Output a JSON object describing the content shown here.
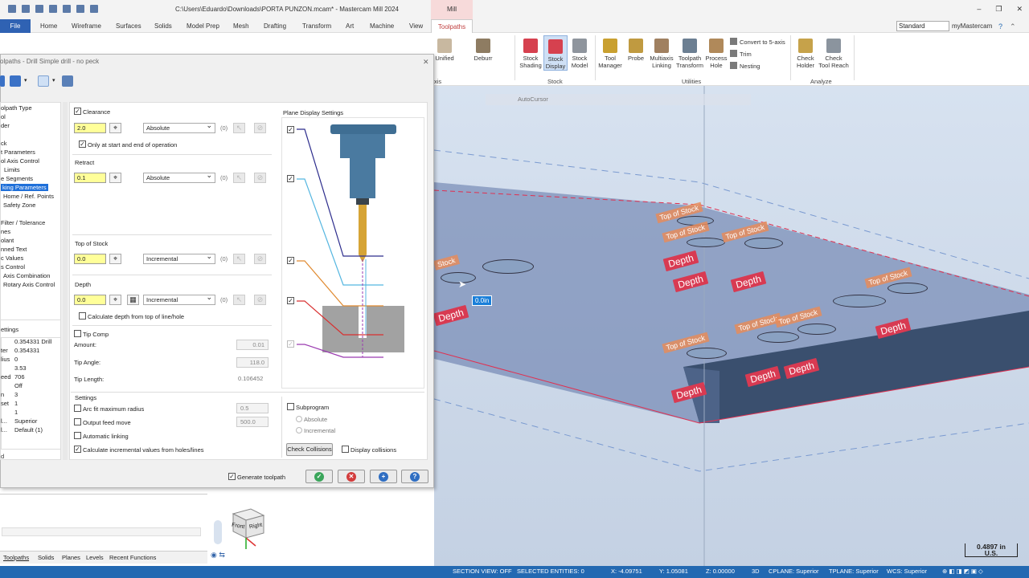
{
  "window": {
    "title": "C:\\Users\\Eduardo\\Downloads\\PORTA PUNZON.mcam* - Mastercam Mill 2024",
    "context_tab": "Mill"
  },
  "menu": {
    "file": "File",
    "tabs": [
      "Home",
      "Wireframe",
      "Surfaces",
      "Solids",
      "Model Prep",
      "Mesh",
      "Drafting",
      "Transform",
      "Art",
      "Machine",
      "View",
      "Toolpaths"
    ],
    "active": "Toolpaths",
    "standard": "Standard",
    "mymastercam": "myMastercam"
  },
  "ribbon": {
    "left_labels": [
      "Unified",
      "Deburr"
    ],
    "stock_group": {
      "label": "Stock",
      "buttons": [
        "Stock\nShading",
        "Stock\nDisplay",
        "Stock\nModel"
      ]
    },
    "utilities_group": {
      "label": "Utilities",
      "buttons": [
        "Tool\nManager",
        "Probe",
        "Multiaxis\nLinking",
        "Toolpath\nTransform",
        "Process\nHole"
      ],
      "small": [
        "Convert to 5-axis",
        "Trim",
        "Nesting"
      ]
    },
    "analyze_group": {
      "label": "Analyze",
      "buttons": [
        "Check\nHolder",
        "Check\nTool Reach"
      ]
    },
    "left_group_partial": "xis"
  },
  "left_tree": [
    "olpath Type",
    "ol",
    "der",
    "",
    "ck",
    "t Parameters",
    "ol Axis Control",
    "Limits",
    "e Segments",
    "king Parameters",
    "Home / Ref. Points",
    "Safety Zone",
    "",
    "Filter / Tolerance",
    "nes",
    "olant",
    "nned Text",
    "c Values",
    "s Control",
    "Axis Combination",
    "Rotary Axis Control"
  ],
  "left_tree_selected": "king Parameters",
  "settings_panel": {
    "header": "ettings",
    "rows": [
      [
        "",
        "0.354331 Drill"
      ],
      [
        "ter",
        "0.354331"
      ],
      [
        "lius",
        "0"
      ],
      [
        "",
        "3.53"
      ],
      [
        "eed",
        "706"
      ],
      [
        "",
        "Off"
      ],
      [
        "n",
        "3"
      ],
      [
        "set",
        "1"
      ],
      [
        "",
        "1"
      ],
      [
        "l...",
        "Superior"
      ],
      [
        "l...",
        "Default (1)"
      ]
    ],
    "foot1": "d",
    "foot2": "led"
  },
  "bottom_tabs": [
    "Toolpaths",
    "Solids",
    "Planes",
    "Levels",
    "Recent Functions"
  ],
  "dialog": {
    "title": "olpaths - Drill Simple drill - no peck",
    "clearance": {
      "label": "Clearance",
      "value": "2.0",
      "mode": "Absolute",
      "only_start_end": "Only at start and end of operation"
    },
    "retract": {
      "label": "Retract",
      "value": "0.1",
      "mode": "Absolute"
    },
    "top_of_stock": {
      "label": "Top of Stock",
      "value": "0.0",
      "mode": "Incremental"
    },
    "depth": {
      "label": "Depth",
      "value": "0.0",
      "mode": "Incremental",
      "calc": "Calculate depth from top of line/hole"
    },
    "zero_marker": "(0)",
    "tip_comp": {
      "label": "Tip Comp",
      "amount_label": "Amount:",
      "amount": "0.01",
      "angle_label": "Tip Angle:",
      "angle": "118.0",
      "length_label": "Tip Length:",
      "length": "0.106452"
    },
    "plane_display": "Plane Display Settings",
    "settings": {
      "label": "Settings",
      "arc_fit": "Arc fit maximum radius",
      "arc_val": "0.5",
      "output_feed": "Output feed move",
      "feed_val": "500.0",
      "auto_link": "Automatic linking",
      "calc_inc": "Calculate incremental values from holes/lines"
    },
    "subprogram": {
      "label": "Subprogram",
      "absolute": "Absolute",
      "incremental": "Incremental"
    },
    "check_collisions": "Check Collisions",
    "display_collisions": "Display collisions",
    "generate": "Generate toolpath"
  },
  "viewport": {
    "autocursor": "AutoCursor",
    "tag_depth": "Depth",
    "tag_top": "Top of Stock",
    "tag_stock": "Stock",
    "readout": "0.0in",
    "scale_value": "0.4897 in",
    "scale_unit": "U.S.",
    "cube_front": "Front",
    "cube_right": "Right"
  },
  "status": {
    "section": "SECTION VIEW: OFF",
    "selected": "SELECTED ENTITIES: 0",
    "x": "X:   -4.09751",
    "y": "Y:   1.05081",
    "z": "Z:   0.00000",
    "mode": "3D",
    "cplane": "CPLANE: Superior",
    "tplane": "TPLANE: Superior",
    "wcs": "WCS: Superior"
  },
  "colors": {
    "accent": "#2369b2",
    "depth_tag": "#d83a52",
    "top_tag": "#e58c5a",
    "highlight_input": "#ffff99"
  }
}
